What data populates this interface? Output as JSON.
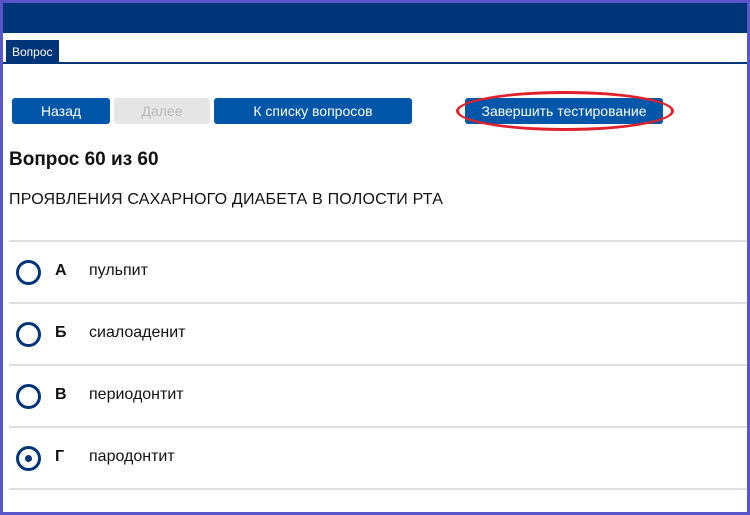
{
  "tabs": {
    "active_label": "Вопрос"
  },
  "nav": {
    "back_label": "Назад",
    "next_label": "Далее",
    "list_label": "К списку вопросов",
    "finish_label": "Завершить тестирование"
  },
  "question": {
    "title": "Вопрос 60 из 60",
    "text": "ПРОЯВЛЕНИЯ САХАРНОГО ДИАБЕТА В ПОЛОСТИ РТА",
    "options": [
      {
        "letter": "А",
        "text": "пульпит",
        "selected": false
      },
      {
        "letter": "Б",
        "text": "сиалоаденит",
        "selected": false
      },
      {
        "letter": "В",
        "text": "периодонтит",
        "selected": false
      },
      {
        "letter": "Г",
        "text": "пародонтит",
        "selected": true
      }
    ]
  },
  "colors": {
    "primary": "#003479",
    "button": "#0056a8",
    "highlight": "#e0202a"
  }
}
